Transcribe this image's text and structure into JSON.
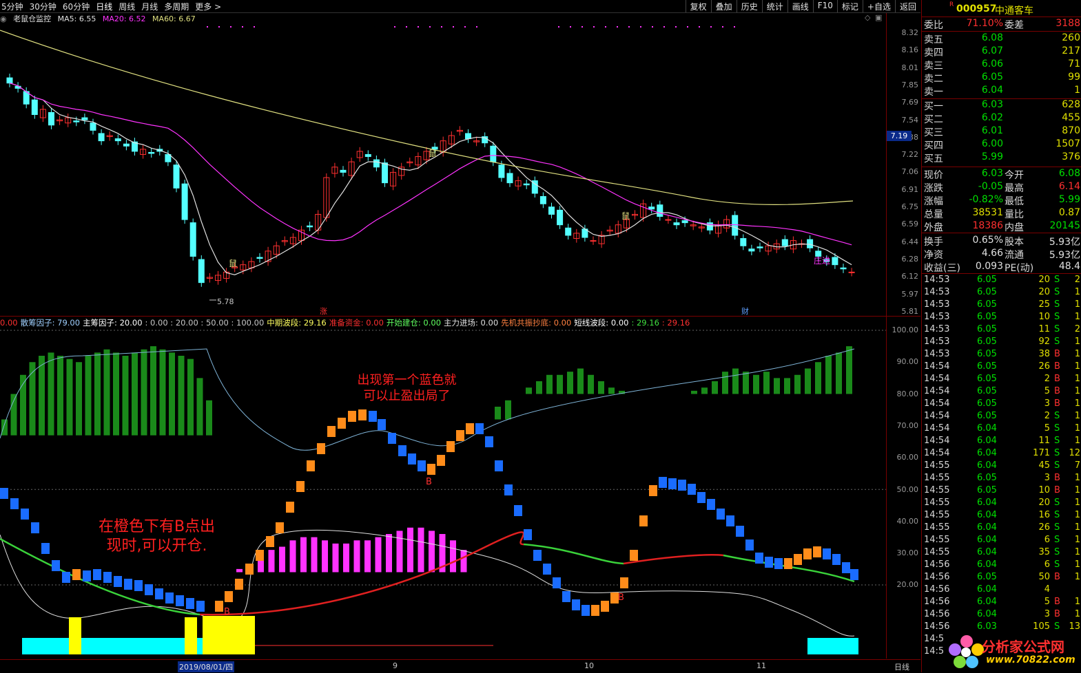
{
  "toolbar": {
    "periods": [
      "5分钟",
      "30分钟",
      "60分钟",
      "日线",
      "周线",
      "月线",
      "多周期",
      "更多 >"
    ],
    "actions": [
      "复权",
      "叠加",
      "历史",
      "统计",
      "画线",
      "F10",
      "标记",
      "+自选",
      "返回"
    ]
  },
  "main_chart": {
    "indicator_name": "老鼠仓监控",
    "ma": [
      {
        "label": "MA5: 6.55",
        "color": "#e0e0e0"
      },
      {
        "label": "MA20: 6.52",
        "color": "#ff33ff"
      },
      {
        "label": "MA60: 6.67",
        "color": "#e0e080"
      }
    ],
    "price_ticks": [
      "8.32",
      "8.16",
      "8.01",
      "7.85",
      "7.69",
      "7.54",
      "7.38",
      "7.22",
      "7.06",
      "6.91",
      "6.75",
      "6.59",
      "6.44",
      "6.28",
      "6.12",
      "5.97",
      "5.81"
    ],
    "current_price_tag": "7.19",
    "low_label": "5.78",
    "marks": [
      "鼠",
      "鼠",
      "鼠",
      "庄进"
    ],
    "event_labels": [
      "涨",
      "财"
    ]
  },
  "oscillator": {
    "values_line": [
      {
        "text": "0.00",
        "color": "#ff3030"
      },
      {
        "text": "散筹因子: 79.00",
        "color": "#a0d0ff"
      },
      {
        "text": "主筹因子: 20.00",
        "color": "#ffffff"
      },
      {
        "text": ": 0.00 : 20.00 : 50.00 : 100.00",
        "color": "#c8c8c8"
      },
      {
        "text": "中期波段: 29.16",
        "color": "#ffff60"
      },
      {
        "text": "准备资金: 0.00",
        "color": "#ff3030"
      },
      {
        "text": "开始建仓: 0.00",
        "color": "#60ff60"
      },
      {
        "text": "主力进场: 0.00",
        "color": "#e0e0e0"
      },
      {
        "text": "先机共振抄底: 0.00",
        "color": "#ff8040"
      },
      {
        "text": "短线波段: 0.00",
        "color": "#ffffff"
      },
      {
        "text": ": 29.16",
        "color": "#40e040"
      },
      {
        "text": ": 29.16",
        "color": "#ff3030"
      }
    ],
    "ticks": [
      "100.00",
      "90.00",
      "80.00",
      "70.00",
      "60.00",
      "50.00",
      "40.00",
      "30.00",
      "20.00"
    ],
    "annotations": [
      "出现第一个蓝色就\n可以止盈出局了",
      "在橙色下有B点出\n现时,可以开仓."
    ],
    "b_marks": [
      "B",
      "B",
      "B"
    ]
  },
  "date_axis": {
    "labels": [
      "2019/08/01/四",
      "9",
      "10",
      "11"
    ],
    "period": "日线"
  },
  "quote_panel": {
    "code": "000957",
    "name": "中通客车",
    "weibi_label": "委比",
    "weibi": "71.10%",
    "weicha_label": "委差",
    "weicha": "3188",
    "asks": [
      {
        "label": "卖五",
        "price": "6.08",
        "vol": "260"
      },
      {
        "label": "卖四",
        "price": "6.07",
        "vol": "217"
      },
      {
        "label": "卖三",
        "price": "6.06",
        "vol": "71"
      },
      {
        "label": "卖二",
        "price": "6.05",
        "vol": "99"
      },
      {
        "label": "卖一",
        "price": "6.04",
        "vol": "1"
      }
    ],
    "bids": [
      {
        "label": "买一",
        "price": "6.03",
        "vol": "628"
      },
      {
        "label": "买二",
        "price": "6.02",
        "vol": "455"
      },
      {
        "label": "买三",
        "price": "6.01",
        "vol": "870"
      },
      {
        "label": "买四",
        "price": "6.00",
        "vol": "1507"
      },
      {
        "label": "买五",
        "price": "5.99",
        "vol": "376"
      }
    ],
    "stats": [
      {
        "l1": "现价",
        "v1": "6.03",
        "c1": "#00e000",
        "l2": "今开",
        "v2": "6.08",
        "c2": "#00e000"
      },
      {
        "l1": "涨跌",
        "v1": "-0.05",
        "c1": "#00e000",
        "l2": "最高",
        "v2": "6.14",
        "c2": "#ff3030"
      },
      {
        "l1": "涨幅",
        "v1": "-0.82%",
        "c1": "#00e000",
        "l2": "最低",
        "v2": "5.99",
        "c2": "#00e000"
      },
      {
        "l1": "总量",
        "v1": "38531",
        "c1": "#e0e000",
        "l2": "量比",
        "v2": "0.87",
        "c2": "#e0e000"
      },
      {
        "l1": "外盘",
        "v1": "18386",
        "c1": "#ff3030",
        "l2": "内盘",
        "v2": "20145",
        "c2": "#00e000"
      },
      {
        "l1": "换手",
        "v1": "0.65%",
        "c1": "#e0e0e0",
        "l2": "股本",
        "v2": "5.93亿",
        "c2": "#e0e0e0"
      },
      {
        "l1": "净资",
        "v1": "4.66",
        "c1": "#e0e0e0",
        "l2": "流通",
        "v2": "5.93亿",
        "c2": "#e0e0e0"
      },
      {
        "l1": "收益(三)",
        "v1": "0.093",
        "c1": "#e0e0e0",
        "l2": "PE(动)",
        "v2": "48.4",
        "c2": "#e0e0e0"
      }
    ],
    "trades": [
      {
        "t": "14:53",
        "p": "6.05",
        "v": "20",
        "d": "S",
        "n": "2"
      },
      {
        "t": "14:53",
        "p": "6.05",
        "v": "20",
        "d": "S",
        "n": "1"
      },
      {
        "t": "14:53",
        "p": "6.05",
        "v": "25",
        "d": "S",
        "n": "1"
      },
      {
        "t": "14:53",
        "p": "6.05",
        "v": "10",
        "d": "S",
        "n": "1"
      },
      {
        "t": "14:53",
        "p": "6.05",
        "v": "11",
        "d": "S",
        "n": "2"
      },
      {
        "t": "14:53",
        "p": "6.05",
        "v": "92",
        "d": "S",
        "n": "1"
      },
      {
        "t": "14:53",
        "p": "6.05",
        "v": "38",
        "d": "B",
        "n": "1"
      },
      {
        "t": "14:54",
        "p": "6.05",
        "v": "26",
        "d": "B",
        "n": "1"
      },
      {
        "t": "14:54",
        "p": "6.05",
        "v": "2",
        "d": "B",
        "n": "1"
      },
      {
        "t": "14:54",
        "p": "6.05",
        "v": "5",
        "d": "B",
        "n": "1"
      },
      {
        "t": "14:54",
        "p": "6.05",
        "v": "3",
        "d": "B",
        "n": "1"
      },
      {
        "t": "14:54",
        "p": "6.05",
        "v": "2",
        "d": "S",
        "n": "1"
      },
      {
        "t": "14:54",
        "p": "6.04",
        "v": "5",
        "d": "S",
        "n": "1"
      },
      {
        "t": "14:54",
        "p": "6.04",
        "v": "11",
        "d": "S",
        "n": "1"
      },
      {
        "t": "14:54",
        "p": "6.04",
        "v": "171",
        "d": "S",
        "n": "12"
      },
      {
        "t": "14:55",
        "p": "6.04",
        "v": "45",
        "d": "S",
        "n": "7"
      },
      {
        "t": "14:55",
        "p": "6.05",
        "v": "3",
        "d": "B",
        "n": "1"
      },
      {
        "t": "14:55",
        "p": "6.05",
        "v": "10",
        "d": "B",
        "n": "1"
      },
      {
        "t": "14:55",
        "p": "6.04",
        "v": "20",
        "d": "S",
        "n": "1"
      },
      {
        "t": "14:55",
        "p": "6.04",
        "v": "16",
        "d": "S",
        "n": "1"
      },
      {
        "t": "14:55",
        "p": "6.04",
        "v": "26",
        "d": "S",
        "n": "1"
      },
      {
        "t": "14:55",
        "p": "6.04",
        "v": "6",
        "d": "S",
        "n": "1"
      },
      {
        "t": "14:55",
        "p": "6.04",
        "v": "35",
        "d": "S",
        "n": "1"
      },
      {
        "t": "14:56",
        "p": "6.04",
        "v": "6",
        "d": "S",
        "n": "1"
      },
      {
        "t": "14:56",
        "p": "6.05",
        "v": "50",
        "d": "B",
        "n": "1"
      },
      {
        "t": "14:56",
        "p": "6.04",
        "v": "4",
        "d": "",
        "n": ""
      },
      {
        "t": "14:56",
        "p": "6.04",
        "v": "5",
        "d": "B",
        "n": "1"
      },
      {
        "t": "14:56",
        "p": "6.04",
        "v": "3",
        "d": "B",
        "n": "1"
      },
      {
        "t": "14:56",
        "p": "6.03",
        "v": "105",
        "d": "S",
        "n": "13"
      },
      {
        "t": "14:5",
        "p": "",
        "v": "",
        "d": "",
        "n": ""
      },
      {
        "t": "14:5",
        "p": "",
        "v": "",
        "d": "",
        "n": ""
      }
    ]
  },
  "watermark": {
    "name": "分析家公式网",
    "url": "www.70822.com"
  },
  "colors": {
    "up": "#ff3030",
    "down": "#54ffff",
    "ma5": "#e0e0e0",
    "ma20": "#ff33ff",
    "ma60": "#e0e080",
    "orange": "#ff8c1a",
    "blue": "#1a6cff",
    "green_bar": "#1a8a1a",
    "magenta_bar": "#ff33ff",
    "yellow": "#ffff00",
    "cyan": "#00ffff"
  }
}
